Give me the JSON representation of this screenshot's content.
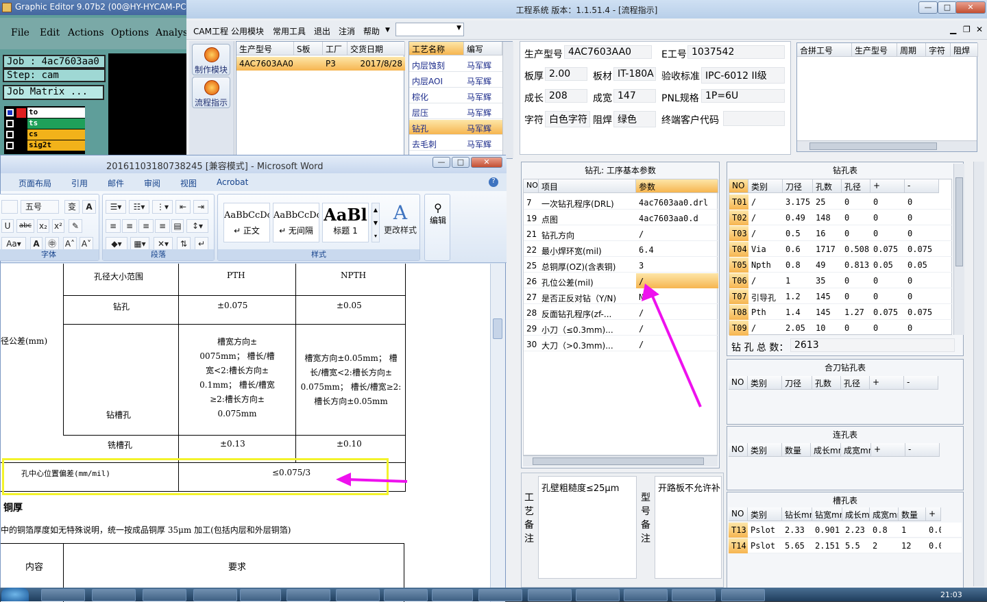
{
  "graphic_editor": {
    "title": "Graphic Editor 9.07b2 (00@HY-HYCAM-PC",
    "menu": [
      "File",
      "Edit",
      "Actions",
      "Options",
      "Analys"
    ],
    "job": "Job : 4ac7603aa0",
    "step": "Step: cam",
    "job_matrix": "Job Matrix ...",
    "layers": [
      {
        "name": "to",
        "color": "#ffffff"
      },
      {
        "name": "ts",
        "color": "#1fa05a"
      },
      {
        "name": "cs",
        "color": "#f2b21a"
      },
      {
        "name": "sig2t",
        "color": "#f2b21a"
      }
    ]
  },
  "main_window": {
    "title": "工程系统   版本：1.1.51.4 - [流程指示]",
    "menu": [
      "CAM工程",
      "公用模块",
      "常用工具",
      "退出",
      "注消",
      "帮助"
    ],
    "side_buttons": [
      "制作模块",
      "流程指示"
    ],
    "order_table": {
      "headers": [
        "生产型号",
        "S板",
        "工厂",
        "交货日期"
      ],
      "rows": [
        [
          "4AC7603AA0",
          "",
          "P3",
          "2017/8/28"
        ]
      ]
    },
    "process_table": {
      "headers": [
        "工艺名称",
        "编写"
      ],
      "rows": [
        [
          "内层蚀刻",
          "马军辉"
        ],
        [
          "内层AOI",
          "马军辉"
        ],
        [
          "棕化",
          "马军辉"
        ],
        [
          "层压",
          "马军辉"
        ],
        [
          "钻孔",
          "马军辉"
        ],
        [
          "去毛刺",
          "马军辉"
        ]
      ],
      "selected": 4
    },
    "info": {
      "pn_label": "生产型号",
      "pn": "4AC7603AA0",
      "eno_label": "E工号",
      "eno": "1037542",
      "thick_label": "板厚",
      "thick": "2.00",
      "mat_label": "板材",
      "mat": "IT-180A",
      "std_label": "验收标准",
      "std": "IPC-6012 II级",
      "len_label": "成长",
      "len": "208",
      "wid_label": "成宽",
      "wid": "147",
      "pnl_label": "PNL规格",
      "pnl": "1P=6U",
      "char_label": "字符",
      "char": "白色字符",
      "mask_label": "阻焊",
      "mask": "绿色",
      "cust_label": "终端客户代码",
      "cust": ""
    },
    "merge_table": {
      "headers": [
        "合拼工号",
        "生产型号",
        "周期",
        "字符",
        "阻焊"
      ]
    },
    "param_panel": {
      "title": "钻孔: 工序基本参数",
      "headers": [
        "NO",
        "项目",
        "参数"
      ],
      "rows": [
        [
          "7",
          "一次钻孔程序(DRL)",
          "4ac7603aa0.drl"
        ],
        [
          "19",
          "点图",
          "4ac7603aa0.d"
        ],
        [
          "21",
          "钻孔方向",
          "/"
        ],
        [
          "22",
          "最小焊环宽(mil)",
          "6.4"
        ],
        [
          "25",
          "总铜厚(OZ)(含表铜)",
          "3"
        ],
        [
          "26",
          "孔位公差(mil)",
          "/"
        ],
        [
          "27",
          "是否正反对钻（Y/N)",
          "N"
        ],
        [
          "28",
          "反面钻孔程序(zf-...",
          "/"
        ],
        [
          "29",
          "小刀（≤0.3mm)...",
          "/"
        ],
        [
          "30",
          "大刀（>0.3mm)...",
          "/"
        ]
      ],
      "selected": 5
    },
    "drill_table": {
      "title": "钻孔表",
      "headers": [
        "NO",
        "类别",
        "刀径",
        "孔数",
        "孔径",
        "+",
        "-"
      ],
      "rows": [
        [
          "T01",
          "/",
          "3.175",
          "25",
          "0",
          "0",
          "0"
        ],
        [
          "T02",
          "/",
          "0.49",
          "148",
          "0",
          "0",
          "0"
        ],
        [
          "T03",
          "/",
          "0.5",
          "16",
          "0",
          "0",
          "0"
        ],
        [
          "T04",
          "Via",
          "0.6",
          "1717",
          "0.508",
          "0.075",
          "0.075"
        ],
        [
          "T05",
          "Npth",
          "0.8",
          "49",
          "0.813",
          "0.05",
          "0.05"
        ],
        [
          "T06",
          "/",
          "1",
          "35",
          "0",
          "0",
          "0"
        ],
        [
          "T07",
          "引导孔",
          "1.2",
          "145",
          "0",
          "0",
          "0"
        ],
        [
          "T08",
          "Pth",
          "1.4",
          "145",
          "1.27",
          "0.075",
          "0.075"
        ],
        [
          "T09",
          "/",
          "2.05",
          "10",
          "0",
          "0",
          "0"
        ]
      ]
    },
    "total_label": "钻 孔 总 数：",
    "total": "2613",
    "combo_table": {
      "title": "合刀钻孔表",
      "headers": [
        "NO",
        "类别",
        "刀径",
        "孔数",
        "孔径",
        "+",
        "-"
      ]
    },
    "link_table": {
      "title": "连孔表",
      "headers": [
        "NO",
        "类别",
        "数量",
        "成长mm",
        "成宽mm",
        "+",
        "-"
      ]
    },
    "slot_table": {
      "title": "槽孔表",
      "headers": [
        "NO",
        "类别",
        "钻长mm",
        "钻宽mm",
        "成长mm",
        "成宽mm",
        "数量",
        "+"
      ],
      "rows": [
        [
          "T13",
          "Pslot",
          "2.33",
          "0.901",
          "2.23",
          "0.8",
          "1",
          "0.0"
        ],
        [
          "T14",
          "Pslot",
          "5.65",
          "2.151",
          "5.5",
          "2",
          "12",
          "0.0"
        ]
      ]
    },
    "remark_label": "工艺备注",
    "remark_text": "孔壁粗糙度≤25μm",
    "model_label": "型号备注",
    "model_text": "开路板不允许补"
  },
  "word": {
    "title": "20161103180738245 [兼容模式] - Microsoft Word",
    "tabs": [
      "页面布局",
      "引用",
      "邮件",
      "审阅",
      "视图",
      "Acrobat"
    ],
    "font_size": "五号",
    "groups": [
      "字体",
      "段落",
      "样式",
      "编辑"
    ],
    "styles": [
      {
        "preview": "AaBbCcDc",
        "name": "↵ 正文"
      },
      {
        "preview": "AaBbCcDc",
        "name": "↵ 无间隔"
      },
      {
        "preview": "AaBl",
        "name": "标题 1"
      }
    ],
    "change_style": "更改样式",
    "edit": "编辑",
    "doc": {
      "h_range": "孔径大小范围",
      "h_pth": "PTH",
      "h_npth": "NPTH",
      "drill": "钻孔",
      "drill_pth": "±0.075",
      "drill_npth": "±0.05",
      "side_label": "径公差(mm)",
      "slot_label": "钻槽孔",
      "slot_pth": [
        "槽宽方向±",
        "0075mm； 槽长/槽",
        "宽<2:槽长方向±",
        "0.1mm； 槽长/槽宽",
        "≥2:槽长方向±",
        "0.075mm"
      ],
      "slot_npth": [
        "槽宽方向±0.05mm； 槽",
        "长/槽宽<2:槽长方向±",
        "0.075mm； 槽长/槽宽≥2:",
        "槽长方向±0.05mm"
      ],
      "mill": "铣槽孔",
      "mill_pth": "±0.13",
      "mill_npth": "±0.10",
      "center": "孔中心位置偏差(mm/mil)",
      "center_val": "≤0.075/3",
      "heading": "铜厚",
      "para": "中的铜箔厚度如无特殊说明，统一按成品铜厚 35μm 加工(包括内层和外层铜箔)",
      "c_content": "内容",
      "c_req": "要求"
    }
  },
  "taskbar": {
    "clock": "21:03"
  }
}
